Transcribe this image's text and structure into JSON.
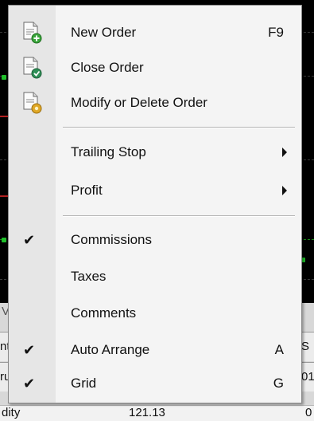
{
  "menu": {
    "items": [
      {
        "label": "New Order",
        "shortcut": "F9",
        "icon": "new-order-icon"
      },
      {
        "label": "Close Order",
        "icon": "close-order-icon"
      },
      {
        "label": "Modify or Delete Order",
        "icon": "modify-order-icon"
      },
      {
        "label": "Trailing Stop",
        "submenu": true
      },
      {
        "label": "Profit",
        "submenu": true
      },
      {
        "label": "Commissions",
        "checked": true
      },
      {
        "label": "Taxes"
      },
      {
        "label": "Comments"
      },
      {
        "label": "Auto Arrange",
        "shortcut": "A",
        "checked": true
      },
      {
        "label": "Grid",
        "shortcut": "G",
        "checked": true
      }
    ],
    "check_glyph": "✔"
  },
  "background": {
    "bottom_cells": [
      "V",
      "nt",
      "ru",
      "dity",
      "121.13",
      "S",
      "01",
      "0"
    ]
  },
  "colors": {
    "menu_bg": "#f4f4f4",
    "gutter": "#e6e6e6",
    "chart_bg": "#000000",
    "grid_green": "#1fbf2a",
    "grid_red": "#b02020"
  }
}
